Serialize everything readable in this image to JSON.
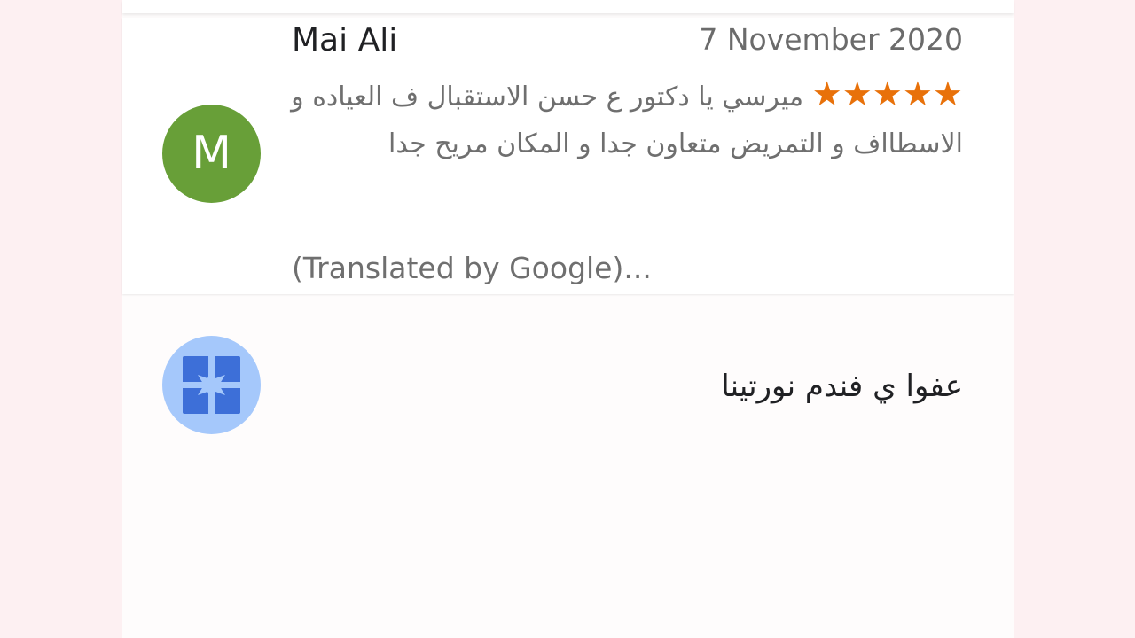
{
  "review": {
    "avatar_letter": "M",
    "avatar_color": "#689f38",
    "reviewer_name": "Mai Ali",
    "date": "7 November 2020",
    "rating_stars": "★★★★★",
    "rating": 5,
    "text": "ميرسي يا دكتور ع حسن الاستقبال ف العياده و الاسطااف و التمريض متعاون جدا و المكان مريح جدا",
    "translated_link": "(Translated by Google)..."
  },
  "reply": {
    "avatar_icon": "business-icon",
    "avatar_color": "#a5c8fb",
    "text": "عفوا ي فندم نورتينا"
  },
  "colors": {
    "star": "#e8710a",
    "background": "#fdf0f2"
  }
}
